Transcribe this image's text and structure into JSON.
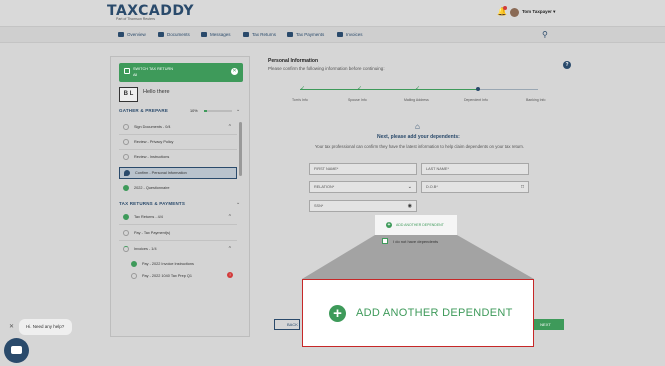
{
  "header": {
    "logo": "TAXCADDY",
    "logo_sub": "Part of Thomson Reuters",
    "user_name": "Tom Taxpayer ▾"
  },
  "nav": {
    "items": [
      {
        "label": "Overview",
        "icon": "home-icon"
      },
      {
        "label": "Documents",
        "icon": "documents-icon"
      },
      {
        "label": "Messages",
        "icon": "messages-icon"
      },
      {
        "label": "Tax Returns",
        "icon": "tax-returns-icon"
      },
      {
        "label": "Tax Payments",
        "icon": "tax-payments-icon"
      },
      {
        "label": "Invoices",
        "icon": "invoices-icon"
      }
    ]
  },
  "sidebar": {
    "switch_line1": "SWITCH TAX RETURN",
    "switch_line2": "All",
    "initials": "B L",
    "greeting": "Hello there",
    "gather_title": "GATHER & PREPARE",
    "gather_pct": "10%",
    "gather_progress": 0.1,
    "gather_items": [
      {
        "label": "Sign Documents - 0/4",
        "state": "open",
        "expander": "^"
      },
      {
        "label": "Review - Privacy Policy",
        "state": "open",
        "expander": ""
      },
      {
        "label": "Review - Instructions",
        "state": "open",
        "expander": ""
      },
      {
        "label": "Confirm - Personal Information",
        "state": "active",
        "expander": ""
      },
      {
        "label": "2022 - Questionnaire",
        "state": "done",
        "expander": ""
      }
    ],
    "returns_title": "TAX RETURNS & PAYMENTS",
    "returns_items": [
      {
        "label": "Tax Returns - 4/4",
        "state": "done",
        "expander": "^"
      },
      {
        "label": "Pay - Tax Payment(s)",
        "state": "open",
        "expander": ""
      },
      {
        "label": "Invoices - 1/4",
        "state": "partial",
        "expander": "^"
      },
      {
        "label": "Pay - 2022 Invoice Instructions",
        "state": "done",
        "expander": ""
      },
      {
        "label": "Pay - 2022 1040 Tax Prep Q1",
        "state": "open",
        "expander": ""
      }
    ],
    "badge": "!"
  },
  "main": {
    "title": "Personal Information",
    "subtitle": "Please confirm the following information before continuing:",
    "steps": [
      "Tom's Info",
      "Spouse Info",
      "Mailing Address",
      "Dependent Info",
      "Banking Info"
    ],
    "heading": "Next, please add your dependents:",
    "description": "Your tax professional can confirm they have the latest information to help claim dependents on your tax return.",
    "fields": {
      "first_name": "FIRST NAME*",
      "last_name": "LAST NAME*",
      "relation": "RELATION*",
      "dob": "D.O.B*",
      "ssn": "SSN*"
    },
    "add_dependent": "ADD ANOTHER DEPENDENT",
    "no_dependents": "I do not have dependents",
    "back": "BACK",
    "next": "NEXT"
  },
  "zoom": {
    "label": "ADD ANOTHER DEPENDENT"
  },
  "chat": {
    "prompt": "Hi. Need any help?"
  },
  "colors": {
    "brand": "#2a4a6b",
    "accent": "#3e9a5a",
    "highlight_border": "#c62828"
  }
}
